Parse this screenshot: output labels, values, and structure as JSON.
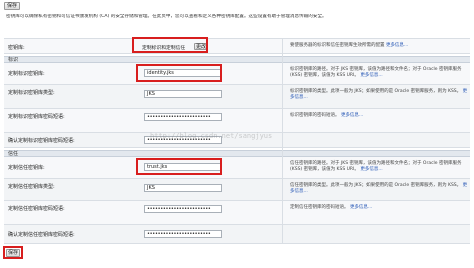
{
  "toolbar": {
    "save_top": "保存",
    "save_bottom": "保存"
  },
  "intro": "密钥库可以确保私有密钥和可信证书颁发机构 (CA) 的安全存储和管理。在此页中，您可以查看和定义各种密钥库配置。这些设置有助于管理消息传输的安全。",
  "keystores": {
    "label": "密钥库:",
    "value": "定制标识和定制信任",
    "change_button": "更改",
    "desc": "要使服务器的标识和信任密钥库生效所需的配置",
    "more": "更多信息..."
  },
  "identity_section": {
    "title": "标识",
    "rows": [
      {
        "label": "定制标识密钥库:",
        "value": "identity.jks",
        "desc": "标识密钥库的路径。对于 JKS 密钥库，该值为路径和文件名；对于 Oracle 密钥库服务 (KSS) 密钥库，该值为 KSS URI。",
        "more": "更多信息..."
      },
      {
        "label": "定制标识密钥库类型:",
        "value": "JKS",
        "desc": "标识密钥库的类型。此项一般为 JKS；如果使用的是 Oracle 密钥库服务，则为 KSS。",
        "more": "更多信息..."
      },
      {
        "label": "定制标识密钥库密码短语:",
        "value": "••••••••••••••••••••••••",
        "desc": "标识密钥库的密码短语。",
        "more": "更多信息..."
      },
      {
        "label": "确认定制标识密钥库密码短语:",
        "value": "••••••••••••••••••••••••",
        "desc": "",
        "more": ""
      }
    ]
  },
  "trust_section": {
    "title": "信任",
    "rows": [
      {
        "label": "定制信任密钥库:",
        "value": "trust.jks",
        "desc": "信任密钥库的路径。对于 JKS 密钥库，该值为路径和文件名；对于 Oracle 密钥库服务 (KSS) 密钥库，该值为 KSS URI。",
        "more": "更多信息..."
      },
      {
        "label": "定制信任密钥库类型:",
        "value": "JKS",
        "desc": "信任密钥库的类型。此项一般为 JKS；如果使用的是 Oracle 密钥库服务，则为 KSS。",
        "more": "更多信息..."
      },
      {
        "label": "定制信任密钥库密码短语:",
        "value": "••••••••••••••••••••••••",
        "desc": "定制信任密钥库的密码短语。",
        "more": "更多信息..."
      },
      {
        "label": "确认定制信任密钥库密码短语:",
        "value": "••••••••••••••••••••••••",
        "desc": "",
        "more": ""
      }
    ]
  },
  "watermark": "http://blog.csdn.net/sangjyus"
}
